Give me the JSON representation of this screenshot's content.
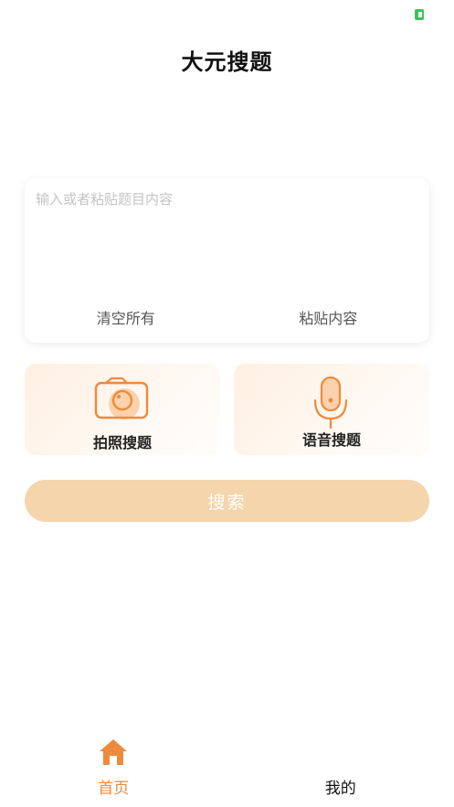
{
  "header": {
    "title": "大元搜题"
  },
  "input": {
    "placeholder": "输入或者粘贴题目内容",
    "value": ""
  },
  "card_actions": {
    "clear_label": "清空所有",
    "paste_label": "粘贴内容"
  },
  "tools": {
    "photo_label": "拍照搜题",
    "voice_label": "语音搜题"
  },
  "search_button": {
    "label": "搜索"
  },
  "tabs": [
    {
      "label": "首页",
      "icon": "home-icon",
      "active": true
    },
    {
      "label": "我的",
      "icon": "",
      "active": false
    }
  ],
  "colors": {
    "accent": "#ee8a3d",
    "button_disabled": "#f5d5ab",
    "battery": "#3fc25a"
  }
}
